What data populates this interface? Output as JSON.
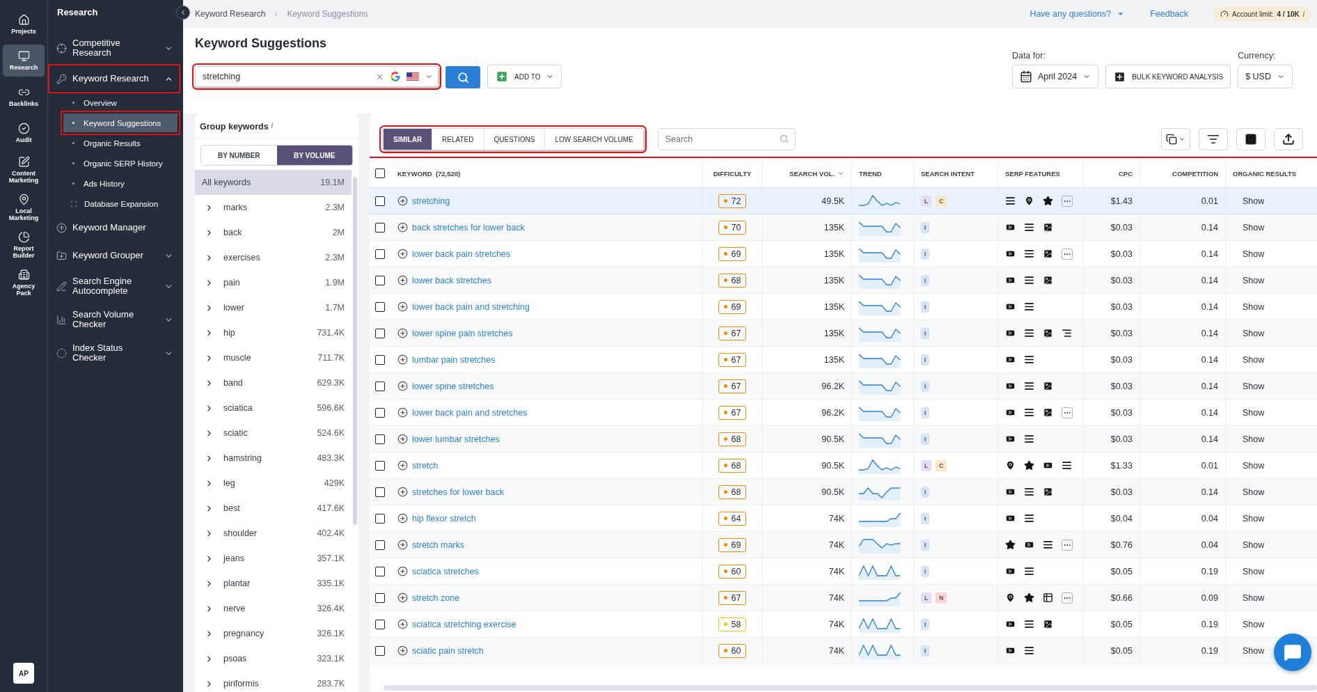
{
  "rail": {
    "items": [
      {
        "label": "Projects",
        "selected": false
      },
      {
        "label": "Research",
        "selected": true
      },
      {
        "label": "Backlinks",
        "selected": false
      },
      {
        "label": "Audit",
        "selected": false
      },
      {
        "label": "Content Marketing",
        "selected": false
      },
      {
        "label": "Local Marketing",
        "selected": false
      },
      {
        "label": "Report Builder",
        "selected": false
      },
      {
        "label": "Agency Pack",
        "selected": false
      }
    ],
    "avatar": "AP"
  },
  "sidebar": {
    "title": "Research",
    "items": [
      {
        "label": "Competitive Research",
        "expandable": true,
        "expanded": false,
        "highlighted": false
      },
      {
        "label": "Keyword Research",
        "expandable": true,
        "expanded": true,
        "highlighted": true,
        "children": [
          {
            "kind": "bullet",
            "label": "Overview",
            "selected": false,
            "highlighted": false
          },
          {
            "kind": "bullet",
            "label": "Keyword Suggestions",
            "selected": true,
            "highlighted": true
          },
          {
            "kind": "bullet",
            "label": "Organic Results",
            "selected": false,
            "highlighted": false
          },
          {
            "kind": "bullet",
            "label": "Organic SERP History",
            "selected": false,
            "highlighted": false
          },
          {
            "kind": "bullet",
            "label": "Ads History",
            "selected": false,
            "highlighted": false
          },
          {
            "kind": "expand",
            "label": "Database Expansion",
            "selected": false,
            "highlighted": false
          }
        ]
      },
      {
        "label": "Keyword Manager",
        "expandable": false,
        "highlighted": false
      },
      {
        "label": "Keyword Grouper",
        "expandable": true,
        "expanded": false,
        "highlighted": false
      },
      {
        "label": "Search Engine Autocomplete",
        "expandable": true,
        "expanded": false,
        "highlighted": false
      },
      {
        "label": "Search Volume Checker",
        "expandable": true,
        "expanded": false,
        "highlighted": false
      },
      {
        "label": "Index Status Checker",
        "expandable": true,
        "expanded": false,
        "highlighted": false
      }
    ]
  },
  "topbar": {
    "breadcrumbs": [
      "Keyword Research",
      "Keyword Suggestions"
    ],
    "help": "Have any questions?",
    "feedback": "Feedback",
    "limit_label": "Account limit:",
    "limit_value": "4 / 10K",
    "limit_info": "i"
  },
  "page": {
    "title": "Keyword Suggestions",
    "search": {
      "value": "stretching",
      "highlighted": true
    },
    "add_to": "ADD TO",
    "data_for_label": "Data for:",
    "date": "April 2024",
    "bulk": "BULK KEYWORD ANALYSIS",
    "currency_label": "Currency:",
    "currency": "$ USD"
  },
  "groups": {
    "title": "Group keywords",
    "info": "i",
    "modes": [
      {
        "label": "BY NUMBER",
        "selected": false
      },
      {
        "label": "BY VOLUME",
        "selected": true
      }
    ],
    "items": [
      {
        "label": "All keywords",
        "value": "19.1M",
        "kind": "all",
        "selected": true
      },
      {
        "label": "marks",
        "value": "2.3M",
        "kind": "group",
        "selected": false
      },
      {
        "label": "back",
        "value": "2M",
        "kind": "group",
        "selected": false
      },
      {
        "label": "exercises",
        "value": "2.3M",
        "kind": "group",
        "selected": false
      },
      {
        "label": "pain",
        "value": "1.9M",
        "kind": "group",
        "selected": false
      },
      {
        "label": "lower",
        "value": "1.7M",
        "kind": "group",
        "selected": false
      },
      {
        "label": "hip",
        "value": "731.4K",
        "kind": "group",
        "selected": false
      },
      {
        "label": "muscle",
        "value": "711.7K",
        "kind": "group",
        "selected": false
      },
      {
        "label": "band",
        "value": "629.3K",
        "kind": "group",
        "selected": false
      },
      {
        "label": "sciatica",
        "value": "596.6K",
        "kind": "group",
        "selected": false
      },
      {
        "label": "sciatic",
        "value": "524.6K",
        "kind": "group",
        "selected": false
      },
      {
        "label": "hamstring",
        "value": "483.3K",
        "kind": "group",
        "selected": false
      },
      {
        "label": "leg",
        "value": "429K",
        "kind": "group",
        "selected": false
      },
      {
        "label": "best",
        "value": "417.6K",
        "kind": "group",
        "selected": false
      },
      {
        "label": "shoulder",
        "value": "402.4K",
        "kind": "group",
        "selected": false
      },
      {
        "label": "jeans",
        "value": "357.1K",
        "kind": "group",
        "selected": false
      },
      {
        "label": "plantar",
        "value": "335.1K",
        "kind": "group",
        "selected": false
      },
      {
        "label": "nerve",
        "value": "326.4K",
        "kind": "group",
        "selected": false
      },
      {
        "label": "pregnancy",
        "value": "326.1K",
        "kind": "group",
        "selected": false
      },
      {
        "label": "psoas",
        "value": "323.1K",
        "kind": "group",
        "selected": false
      },
      {
        "label": "piriformis",
        "value": "283.7K",
        "kind": "group",
        "selected": false
      }
    ]
  },
  "results": {
    "tabs": {
      "highlighted": true,
      "items": [
        {
          "label": "SIMILAR",
          "selected": true
        },
        {
          "label": "RELATED",
          "selected": false
        },
        {
          "label": "QUESTIONS",
          "selected": false
        },
        {
          "label": "LOW SEARCH VOLUME",
          "selected": false
        }
      ]
    },
    "search": {
      "placeholder": "Search"
    },
    "table": {
      "highlighted": true,
      "select_all": {
        "checked": false
      },
      "columns": [
        {
          "label": "KEYWORD  (72,520)",
          "sorted": false
        },
        {
          "label": "DIFFICULTY",
          "sorted": false
        },
        {
          "label": "SEARCH VOL.",
          "sorted": true
        },
        {
          "label": "TREND",
          "sorted": false
        },
        {
          "label": "SEARCH INTENT",
          "sorted": false
        },
        {
          "label": "SERP FEATURES",
          "sorted": false
        },
        {
          "label": "CPC",
          "sorted": false
        },
        {
          "label": "COMPETITION",
          "sorted": false
        },
        {
          "label": "ORGANIC RESULTS",
          "sorted": false
        }
      ],
      "rows": [
        {
          "checked": false,
          "hovered": true,
          "keyword": "stretching",
          "difficulty": "72",
          "color": "#f08c00",
          "volume": "49.5K",
          "intent": [
            {
              "label": "L",
              "color": "#e6dcf3"
            },
            {
              "label": "C",
              "color": "#fde6c4"
            }
          ],
          "serp": [
            {
              "kind": "list"
            },
            {
              "kind": "pin"
            },
            {
              "kind": "star"
            },
            {
              "kind": "more"
            }
          ],
          "cpc": "$1.43",
          "competition": "0.01",
          "organic": "Show"
        },
        {
          "checked": false,
          "hovered": false,
          "keyword": "back stretches for lower back",
          "difficulty": "70",
          "color": "#f08c00",
          "volume": "135K",
          "intent": [
            {
              "label": "I",
              "color": "#d5e5f6"
            }
          ],
          "serp": [
            {
              "kind": "video"
            },
            {
              "kind": "list"
            },
            {
              "kind": "image"
            }
          ],
          "cpc": "$0.03",
          "competition": "0.14",
          "organic": "Show"
        },
        {
          "checked": false,
          "hovered": false,
          "keyword": "lower back pain stretches",
          "difficulty": "69",
          "color": "#f08c00",
          "volume": "135K",
          "intent": [
            {
              "label": "I",
              "color": "#d5e5f6"
            }
          ],
          "serp": [
            {
              "kind": "video"
            },
            {
              "kind": "list"
            },
            {
              "kind": "image"
            },
            {
              "kind": "more"
            }
          ],
          "cpc": "$0.03",
          "competition": "0.14",
          "organic": "Show"
        },
        {
          "checked": false,
          "hovered": false,
          "keyword": "lower back stretches",
          "difficulty": "68",
          "color": "#f08c00",
          "volume": "135K",
          "intent": [
            {
              "label": "I",
              "color": "#d5e5f6"
            }
          ],
          "serp": [
            {
              "kind": "video"
            },
            {
              "kind": "list"
            },
            {
              "kind": "image"
            }
          ],
          "cpc": "$0.03",
          "competition": "0.14",
          "organic": "Show"
        },
        {
          "checked": false,
          "hovered": false,
          "keyword": "lower back pain and stretching",
          "difficulty": "69",
          "color": "#f08c00",
          "volume": "135K",
          "intent": [
            {
              "label": "I",
              "color": "#d5e5f6"
            }
          ],
          "serp": [
            {
              "kind": "video"
            },
            {
              "kind": "list"
            }
          ],
          "cpc": "$0.03",
          "competition": "0.14",
          "organic": "Show"
        },
        {
          "checked": false,
          "hovered": false,
          "keyword": "lower spine pain stretches",
          "difficulty": "67",
          "color": "#f08c00",
          "volume": "135K",
          "intent": [
            {
              "label": "I",
              "color": "#d5e5f6"
            }
          ],
          "serp": [
            {
              "kind": "video"
            },
            {
              "kind": "list"
            },
            {
              "kind": "image"
            },
            {
              "kind": "lines"
            }
          ],
          "cpc": "$0.03",
          "competition": "0.14",
          "organic": "Show"
        },
        {
          "checked": false,
          "hovered": false,
          "keyword": "lumbar pain stretches",
          "difficulty": "67",
          "color": "#f08c00",
          "volume": "135K",
          "intent": [
            {
              "label": "I",
              "color": "#d5e5f6"
            }
          ],
          "serp": [
            {
              "kind": "video"
            },
            {
              "kind": "list"
            }
          ],
          "cpc": "$0.03",
          "competition": "0.14",
          "organic": "Show"
        },
        {
          "checked": false,
          "hovered": false,
          "keyword": "lower spine stretches",
          "difficulty": "67",
          "color": "#f08c00",
          "volume": "96.2K",
          "intent": [
            {
              "label": "I",
              "color": "#d5e5f6"
            }
          ],
          "serp": [
            {
              "kind": "video"
            },
            {
              "kind": "list"
            },
            {
              "kind": "image"
            }
          ],
          "cpc": "$0.03",
          "competition": "0.14",
          "organic": "Show"
        },
        {
          "checked": false,
          "hovered": false,
          "keyword": "lower back pain and stretches",
          "difficulty": "67",
          "color": "#f08c00",
          "volume": "96.2K",
          "intent": [
            {
              "label": "I",
              "color": "#d5e5f6"
            }
          ],
          "serp": [
            {
              "kind": "video"
            },
            {
              "kind": "list"
            },
            {
              "kind": "image"
            },
            {
              "kind": "more"
            }
          ],
          "cpc": "$0.03",
          "competition": "0.14",
          "organic": "Show"
        },
        {
          "checked": false,
          "hovered": false,
          "keyword": "lower lumbar stretches",
          "difficulty": "68",
          "color": "#f08c00",
          "volume": "90.5K",
          "intent": [
            {
              "label": "I",
              "color": "#d5e5f6"
            }
          ],
          "serp": [
            {
              "kind": "video"
            },
            {
              "kind": "list"
            }
          ],
          "cpc": "$0.03",
          "competition": "0.14",
          "organic": "Show"
        },
        {
          "checked": false,
          "hovered": false,
          "keyword": "stretch",
          "difficulty": "68",
          "color": "#f08c00",
          "volume": "90.5K",
          "intent": [
            {
              "label": "L",
              "color": "#e6dcf3"
            },
            {
              "label": "C",
              "color": "#fde6c4"
            }
          ],
          "serp": [
            {
              "kind": "pin"
            },
            {
              "kind": "star"
            },
            {
              "kind": "video"
            },
            {
              "kind": "list"
            }
          ],
          "cpc": "$1.33",
          "competition": "0.01",
          "organic": "Show"
        },
        {
          "checked": false,
          "hovered": false,
          "keyword": "stretches for lower back",
          "difficulty": "68",
          "color": "#f08c00",
          "volume": "90.5K",
          "intent": [
            {
              "label": "I",
              "color": "#d5e5f6"
            }
          ],
          "serp": [
            {
              "kind": "video"
            },
            {
              "kind": "list"
            },
            {
              "kind": "image"
            }
          ],
          "cpc": "$0.03",
          "competition": "0.14",
          "organic": "Show"
        },
        {
          "checked": false,
          "hovered": false,
          "keyword": "hip flexor stretch",
          "difficulty": "64",
          "color": "#f08c00",
          "volume": "74K",
          "intent": [
            {
              "label": "I",
              "color": "#d5e5f6"
            }
          ],
          "serp": [
            {
              "kind": "video"
            },
            {
              "kind": "list"
            }
          ],
          "cpc": "$0.04",
          "competition": "0.04",
          "organic": "Show"
        },
        {
          "checked": false,
          "hovered": false,
          "keyword": "stretch marks",
          "difficulty": "69",
          "color": "#f08c00",
          "volume": "74K",
          "intent": [
            {
              "label": "I",
              "color": "#d5e5f6"
            }
          ],
          "serp": [
            {
              "kind": "star"
            },
            {
              "kind": "video"
            },
            {
              "kind": "list"
            },
            {
              "kind": "more"
            }
          ],
          "cpc": "$0.76",
          "competition": "0.04",
          "organic": "Show"
        },
        {
          "checked": false,
          "hovered": false,
          "keyword": "sciatica stretches",
          "difficulty": "60",
          "color": "#f08c00",
          "volume": "74K",
          "intent": [
            {
              "label": "I",
              "color": "#d5e5f6"
            }
          ],
          "serp": [
            {
              "kind": "video"
            },
            {
              "kind": "list"
            }
          ],
          "cpc": "$0.05",
          "competition": "0.19",
          "organic": "Show"
        },
        {
          "checked": false,
          "hovered": false,
          "keyword": "stretch zone",
          "difficulty": "67",
          "color": "#f08c00",
          "volume": "74K",
          "intent": [
            {
              "label": "L",
              "color": "#e6dcf3"
            },
            {
              "label": "N",
              "color": "#fbd6d6"
            }
          ],
          "serp": [
            {
              "kind": "pin"
            },
            {
              "kind": "star"
            },
            {
              "kind": "table"
            },
            {
              "kind": "more"
            }
          ],
          "cpc": "$0.66",
          "competition": "0.09",
          "organic": "Show"
        },
        {
          "checked": false,
          "hovered": false,
          "keyword": "sciatica stretching exercise",
          "difficulty": "58",
          "color": "#f5c400",
          "volume": "74K",
          "intent": [
            {
              "label": "I",
              "color": "#d5e5f6"
            }
          ],
          "serp": [
            {
              "kind": "video"
            },
            {
              "kind": "list"
            },
            {
              "kind": "image"
            }
          ],
          "cpc": "$0.05",
          "competition": "0.19",
          "organic": "Show"
        },
        {
          "checked": false,
          "hovered": false,
          "keyword": "sciatic pain stretch",
          "difficulty": "60",
          "color": "#f08c00",
          "volume": "74K",
          "intent": [
            {
              "label": "I",
              "color": "#d5e5f6"
            }
          ],
          "serp": [
            {
              "kind": "video"
            },
            {
              "kind": "list"
            }
          ],
          "cpc": "$0.05",
          "competition": "0.19",
          "organic": "Show"
        }
      ]
    }
  }
}
